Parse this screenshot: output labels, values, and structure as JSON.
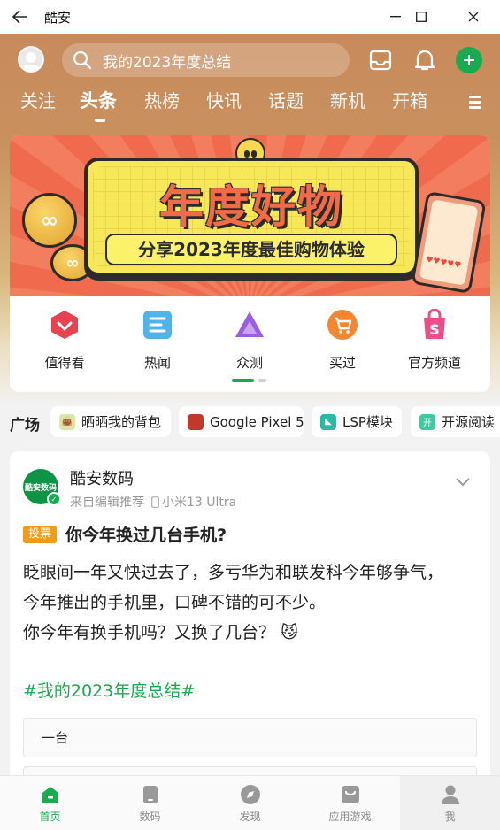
{
  "window": {
    "title": "酷安"
  },
  "header": {
    "search_text": "我的2023年度总结",
    "tabs": [
      "关注",
      "头条",
      "热榜",
      "快讯",
      "话题",
      "新机",
      "开箱"
    ],
    "active_tab": "头条"
  },
  "banner": {
    "title": "年度好物",
    "subtitle": "分享2023年度最佳购物体验"
  },
  "quick_links": [
    {
      "label": "值得看",
      "icon": "heart-check-icon",
      "color": "#e8414f"
    },
    {
      "label": "热闻",
      "icon": "document-icon",
      "color": "#4db5ec"
    },
    {
      "label": "众测",
      "icon": "triangle-icon",
      "color": "#9b5de5"
    },
    {
      "label": "买过",
      "icon": "cart-icon",
      "color": "#f5862e"
    },
    {
      "label": "官方频道",
      "icon": "shopping-bag-icon",
      "color": "#ef4d8a"
    }
  ],
  "plaza": {
    "label": "广场",
    "chips": [
      "晒晒我的背包",
      "Google Pixel 5",
      "LSP模块",
      "开源阅读"
    ]
  },
  "post": {
    "author": "酷安数码",
    "avatar_text": "酷安数码",
    "recommend": "来自编辑推荐",
    "device": "小米13 Ultra",
    "badge": "投票",
    "title": "你今年换过几台手机?",
    "body_lines": [
      "眨眼间一年又快过去了，多亏华为和联发科今年够争气，",
      "今年推出的手机里，口碑不错的可不少。",
      "你今年有换手机吗？又换了几台？"
    ],
    "emoji": "😼",
    "hashtag": "#我的2023年度总结#",
    "option_1": "一台"
  },
  "bottom_nav": [
    {
      "label": "首页",
      "icon": "home-icon"
    },
    {
      "label": "数码",
      "icon": "phone-icon"
    },
    {
      "label": "发现",
      "icon": "compass-icon"
    },
    {
      "label": "应用游戏",
      "icon": "app-store-icon"
    },
    {
      "label": "我",
      "icon": "user-icon"
    }
  ],
  "colors": {
    "accent": "#1aaa50",
    "banner": "#f06a4e",
    "vote": "#f29a1a"
  }
}
